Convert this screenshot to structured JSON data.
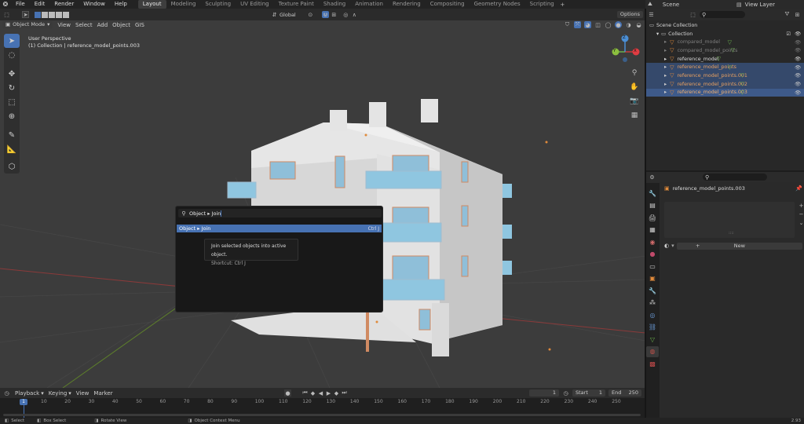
{
  "topbar": {
    "menus": [
      "File",
      "Edit",
      "Render",
      "Window",
      "Help"
    ],
    "workspaces": [
      "Layout",
      "Modeling",
      "Sculpting",
      "UV Editing",
      "Texture Paint",
      "Shading",
      "Animation",
      "Rendering",
      "Compositing",
      "Geometry Nodes",
      "Scripting"
    ],
    "active_workspace": "Layout",
    "scene_label": "Scene",
    "view_layer_label": "View Layer"
  },
  "toolheader": {
    "transform_orientation": "Global",
    "options_label": "Options"
  },
  "viewport_header": {
    "mode": "Object Mode",
    "menus": [
      "View",
      "Select",
      "Add",
      "Object",
      "GIS"
    ]
  },
  "viewport": {
    "perspective": "User Perspective",
    "collection_info": "(1) Collection | reference_model_points.003",
    "axis_x": "X",
    "axis_y": "Y",
    "axis_z": "Z"
  },
  "search_popup": {
    "query": "Object ▸ Join",
    "result_label": "Object ▸ Join",
    "result_shortcut": "Ctrl J",
    "tooltip_desc": "Join selected objects into active object.",
    "tooltip_shortcut": "Shortcut: Ctrl J"
  },
  "outliner": {
    "scene_collection": "Scene Collection",
    "collection": "Collection",
    "items": [
      {
        "name": "compared_model",
        "state": "dim"
      },
      {
        "name": "compared_model_points",
        "state": "dim"
      },
      {
        "name": "reference_model",
        "state": "normal"
      },
      {
        "name": "reference_model_points",
        "state": "selected"
      },
      {
        "name": "reference_model_points.001",
        "state": "selected"
      },
      {
        "name": "reference_model_points.002",
        "state": "selected"
      },
      {
        "name": "reference_model_points.003",
        "state": "active"
      }
    ]
  },
  "properties": {
    "object_name": "reference_model_points.003",
    "new_label": "New",
    "list_dots": "::::"
  },
  "timeline": {
    "menus": [
      "Playback",
      "Keying",
      "View",
      "Marker"
    ],
    "current_frame": "1",
    "start_label": "Start",
    "start_value": "1",
    "end_label": "End",
    "end_value": "250",
    "ticks": [
      "1",
      "10",
      "20",
      "30",
      "40",
      "50",
      "60",
      "70",
      "80",
      "90",
      "100",
      "110",
      "120",
      "130",
      "140",
      "150",
      "160",
      "170",
      "180",
      "190",
      "200",
      "210",
      "220",
      "230",
      "240",
      "250"
    ]
  },
  "statusbar": {
    "items": [
      "Select",
      "Box Select",
      "Rotate View",
      "Object Context Menu"
    ],
    "version": "2.93"
  },
  "colors": {
    "accent": "#4772b3",
    "selected_row": "#35496b",
    "active_row": "#3e5a8a",
    "object_orange": "#e08a3b",
    "mesh_green": "#6ab04c"
  }
}
